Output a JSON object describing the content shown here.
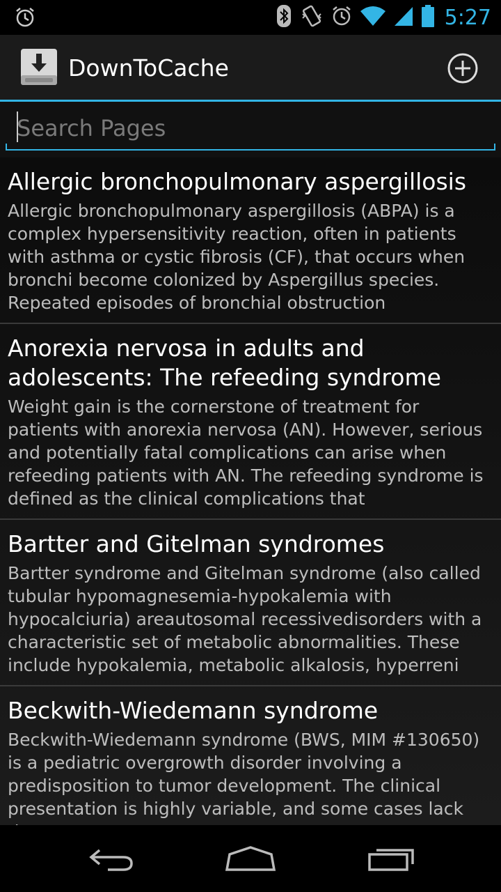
{
  "status_bar": {
    "time": "5:27",
    "icons": [
      "alarm-icon",
      "bluetooth-icon",
      "vibrate-icon",
      "alarm-icon",
      "wifi-icon",
      "signal-icon",
      "battery-icon"
    ]
  },
  "action_bar": {
    "title": "DownToCache",
    "add_icon": "plus-circle-icon"
  },
  "search": {
    "placeholder": "Search Pages",
    "value": ""
  },
  "pages": [
    {
      "title": "Allergic bronchopulmonary aspergillosis",
      "description": "Allergic bronchopulmonary aspergillosis (ABPA) is a complex hypersensitivity reaction, often in patients with asthma or cystic fibrosis (CF), that occurs when bronchi become colonized by Aspergillus species. Repeated episodes of bronchial obstruction"
    },
    {
      "title": "Anorexia nervosa in adults and adolescents: The refeeding syndrome",
      "description": "Weight gain is the cornerstone of treatment for patients with anorexia nervosa (AN). However, serious and potentially fatal complications can arise when refeeding patients with AN. The refeeding syndrome is defined as the clinical complications that"
    },
    {
      "title": "Bartter and Gitelman syndromes",
      "description": "Bartter syndrome and Gitelman syndrome (also called tubular hypomagnesemia-hypokalemia with hypocalciuria) areautosomal recessivedisorders with a characteristic set of metabolic abnormalities. These include hypokalemia, metabolic alkalosis, hyperreni"
    },
    {
      "title": "Beckwith-Wiedemann syndrome",
      "description": "Beckwith-Wiedemann syndrome (BWS, MIM #130650) is a pediatric overgrowth disorder involving a predisposition to tumor development. The clinical presentation is highly variable, and some cases lack the"
    }
  ],
  "nav_bar": {
    "buttons": [
      "back-icon",
      "home-icon",
      "recents-icon"
    ]
  },
  "colors": {
    "accent": "#33b5e5",
    "background": "#000000",
    "description_text": "#bdbdbd"
  }
}
